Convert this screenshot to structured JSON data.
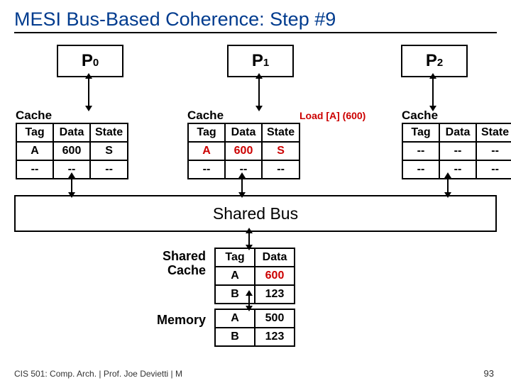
{
  "title": "MESI Bus-Based Coherence: Step #9",
  "processors": {
    "p0": "P",
    "p0_sub": "0",
    "p1": "P",
    "p1_sub": "1",
    "p2": "P",
    "p2_sub": "2"
  },
  "cache_label": "Cache",
  "headers": {
    "tag": "Tag",
    "data": "Data",
    "state": "State"
  },
  "p0_cache": {
    "r1": {
      "tag": "A",
      "data": "600",
      "state": "S"
    },
    "r2": {
      "tag": "--",
      "data": "--",
      "state": "--"
    }
  },
  "p1_cache": {
    "r1": {
      "tag": "A",
      "data": "600",
      "state": "S"
    },
    "r2": {
      "tag": "--",
      "data": "--",
      "state": "--"
    }
  },
  "p2_cache": {
    "r1": {
      "tag": "--",
      "data": "--",
      "state": "--"
    },
    "r2": {
      "tag": "--",
      "data": "--",
      "state": "--"
    }
  },
  "load_label": "Load [A] (600)",
  "bus_label": "Shared Bus",
  "shared_cache_label": "Shared Cache",
  "shared_cache": {
    "h": {
      "tag": "Tag",
      "data": "Data"
    },
    "r1": {
      "tag": "A",
      "data": "600"
    },
    "r2": {
      "tag": "B",
      "data": "123"
    }
  },
  "memory_label": "Memory",
  "memory": {
    "r1": {
      "tag": "A",
      "data": "500"
    },
    "r2": {
      "tag": "B",
      "data": "123"
    }
  },
  "footer": "CIS 501: Comp. Arch.  |  Prof. Joe Devietti  |  M",
  "page": "93"
}
